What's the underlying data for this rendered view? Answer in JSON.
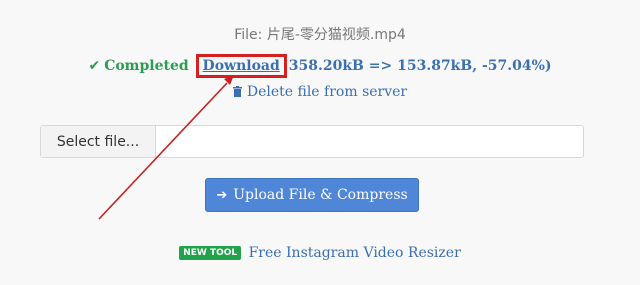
{
  "file_line": "File: 片尾-零分猫视频.mp4",
  "status": {
    "check_icon": "✔",
    "completed_label": "Completed",
    "download_label": "Download",
    "size_info": "358.20kB => 153.87kB, -57.04%)"
  },
  "delete_link_label": "Delete file from server",
  "file_input": {
    "button_label": "Select file...",
    "file_name": ""
  },
  "upload_button_label": "Upload File & Compress",
  "arrow_icon": "➔",
  "tool_promo": {
    "badge": "NEW TOOL",
    "link_label": "Free Instagram Video Resizer"
  },
  "colors": {
    "success_green": "#2a9d4e",
    "link_blue": "#3a6fb2",
    "highlight_red": "#d62020",
    "button_blue": "#4f86d8",
    "badge_green": "#22a34a"
  },
  "icons": {
    "check": "check-icon",
    "trash": "trash-icon",
    "upload_arrow": "arrow-right-icon",
    "annotation": "red-annotation-arrow"
  }
}
